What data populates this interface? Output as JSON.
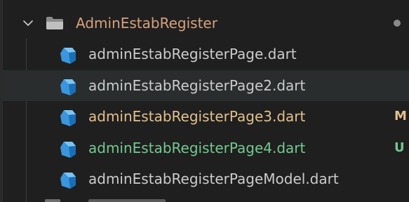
{
  "folder": {
    "name": "AdminEstabRegister",
    "expanded": true,
    "color": "#d7a27c",
    "icon": "folder-open-icon",
    "chevron_icon": "chevron-down-icon"
  },
  "files": [
    {
      "name": "adminEstabRegisterPage.dart",
      "color": "#cccccc",
      "badge": "",
      "selected": false,
      "icon": "dart-file-icon"
    },
    {
      "name": "adminEstabRegisterPage2.dart",
      "color": "#cccccc",
      "badge": "",
      "selected": true,
      "icon": "dart-file-icon"
    },
    {
      "name": "adminEstabRegisterPage3.dart",
      "color": "#e2c08d",
      "badge": "M",
      "badge_color": "#e2c08d",
      "selected": false,
      "icon": "dart-file-icon"
    },
    {
      "name": "adminEstabRegisterPage4.dart",
      "color": "#73c991",
      "badge": "U",
      "badge_color": "#73c991",
      "selected": false,
      "icon": "dart-file-icon"
    },
    {
      "name": "adminEstabRegisterPageModel.dart",
      "color": "#cccccc",
      "badge": "",
      "selected": false,
      "icon": "dart-file-icon"
    }
  ],
  "colors": {
    "background": "#1f1f1f",
    "selected_row": "#2a2d2e",
    "dart_icon": "#3b96dd"
  }
}
